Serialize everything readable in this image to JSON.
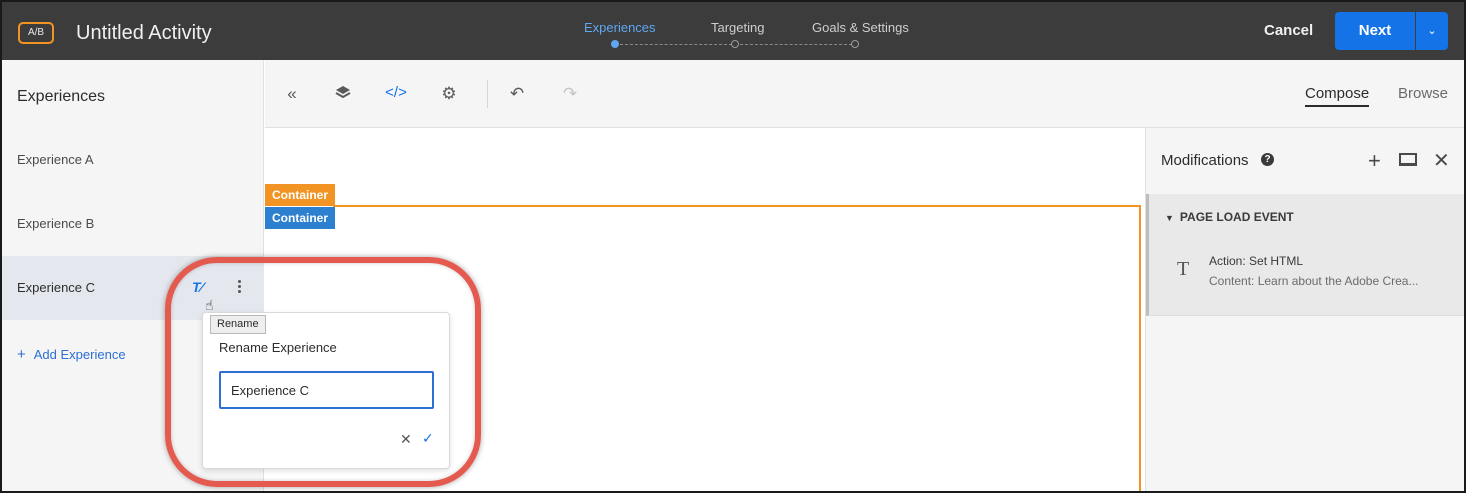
{
  "header": {
    "badge": "A/B",
    "activity_title": "Untitled Activity",
    "steps": [
      {
        "label": "Experiences",
        "active": true
      },
      {
        "label": "Targeting",
        "active": false
      },
      {
        "label": "Goals & Settings",
        "active": false
      }
    ],
    "cancel_label": "Cancel",
    "next_label": "Next"
  },
  "sidebar": {
    "title": "Experiences",
    "items": [
      {
        "label": "Experience A"
      },
      {
        "label": "Experience B"
      },
      {
        "label": "Experience C",
        "selected": true
      }
    ],
    "add_label": "Add Experience"
  },
  "toolbar": {
    "tabs": {
      "compose": "Compose",
      "browse": "Browse"
    },
    "icons": [
      "collapse-icon",
      "layers-icon",
      "code-icon",
      "settings-icon",
      "undo-icon",
      "redo-icon"
    ]
  },
  "canvas": {
    "container_orange": "Container",
    "container_blue": "Container"
  },
  "modifications": {
    "title": "Modifications",
    "event_header": "PAGE LOAD EVENT",
    "action_title": "Action: Set HTML",
    "action_content": "Content: Learn about the Adobe Crea..."
  },
  "rename_popover": {
    "tooltip": "Rename",
    "title": "Rename Experience",
    "input_value": "Experience C"
  },
  "colors": {
    "topbar": "#3c3c3c",
    "accent_blue": "#1473e6",
    "orange": "#f29423",
    "highlight": "#e55a4f"
  }
}
